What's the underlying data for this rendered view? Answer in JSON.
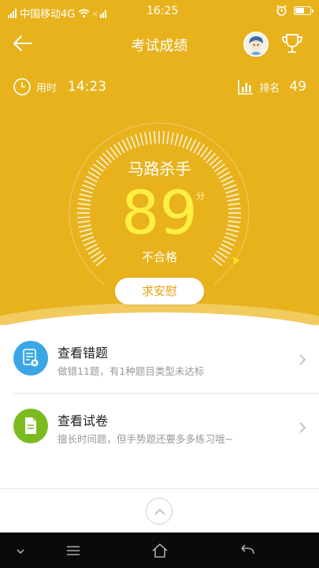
{
  "status_bar": {
    "carrier": "中国移动4G",
    "time": "16:25"
  },
  "header": {
    "title": "考试成绩"
  },
  "stats": {
    "time_label": "用时",
    "time_value": "14:23",
    "rank_label": "排名",
    "rank_value": "49"
  },
  "result": {
    "title": "马路杀手",
    "score": "89",
    "score_unit": "分",
    "verdict": "不合格",
    "comfort_button": "求安慰"
  },
  "menu": [
    {
      "title": "查看错题",
      "subtitle": "做错11题，有1种题目类型未达标",
      "icon": "wrong-questions-icon",
      "color": "#3aa6e6"
    },
    {
      "title": "查看试卷",
      "subtitle": "擅长时间题，但手势题还要多多练习哦~",
      "icon": "exam-paper-icon",
      "color": "#7cbb1f"
    }
  ],
  "colors": {
    "primary": "#e7b21c",
    "score": "#ffef42"
  }
}
